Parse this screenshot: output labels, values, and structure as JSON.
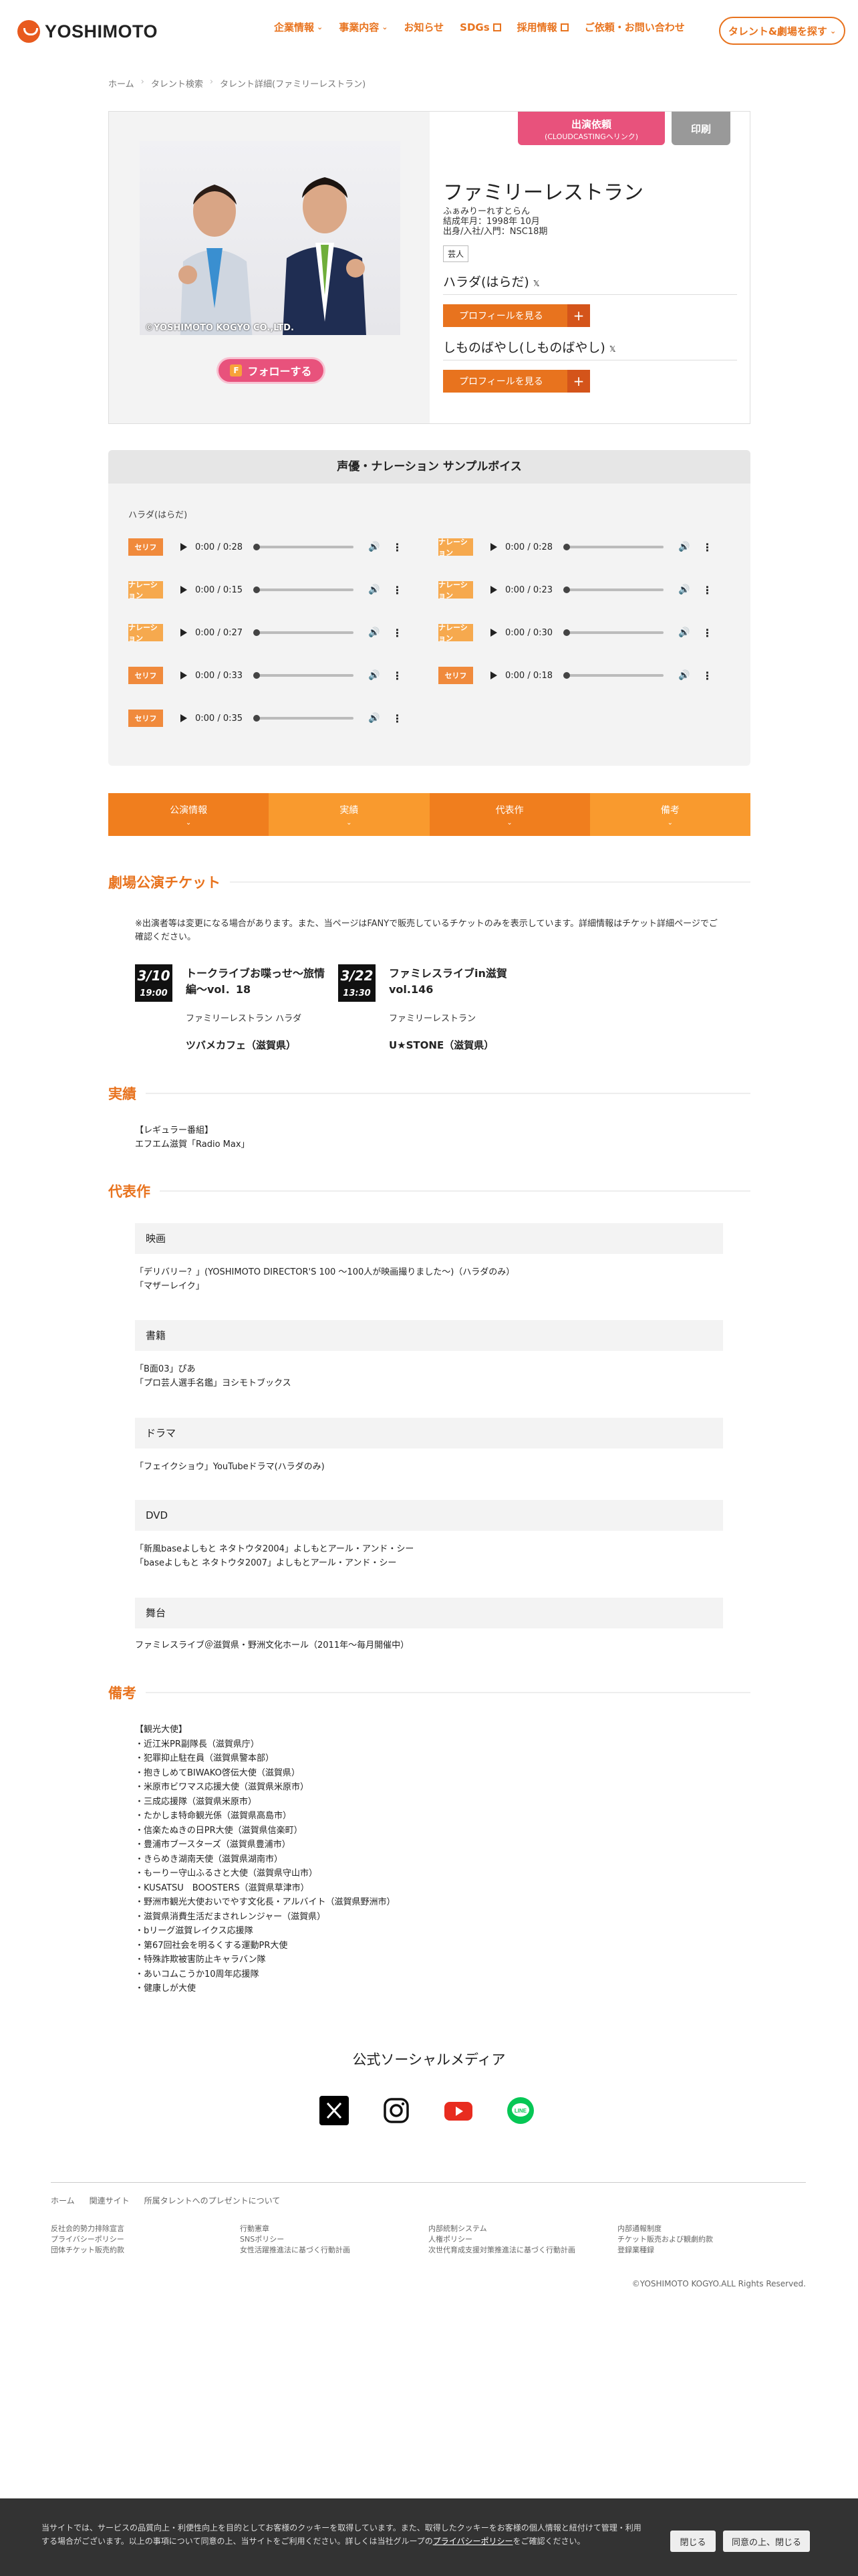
{
  "header": {
    "logo": "YOSHIMOTO",
    "nav": [
      {
        "label": "企業情報",
        "type": "dropdown"
      },
      {
        "label": "事業内容",
        "type": "dropdown"
      },
      {
        "label": "お知らせ",
        "type": "link"
      },
      {
        "label": "SDGs",
        "type": "external"
      },
      {
        "label": "採用情報",
        "type": "external"
      },
      {
        "label": "ご依頼・お問い合わせ",
        "type": "link"
      }
    ],
    "talent_button": "タレント&劇場を探す"
  },
  "breadcrumb": [
    "ホーム",
    "タレント検索",
    "タレント詳細(ファミリーレストラン)"
  ],
  "profile": {
    "photo_caption": "©YOSHIMOTO KOGYO CO.,LTD.",
    "follow": "フォローする",
    "order_line1": "出演依頼",
    "order_line2": "(CLOUDCASTINGへリンク)",
    "print": "印刷",
    "name": "ファミリーレストラン",
    "kana": "ふぁみりーれすとらん",
    "formed": "結成年月：1998年 10月",
    "origin": "出身/入社/入門：NSC18期",
    "tag": "芸人",
    "members": [
      {
        "name": "ハラダ(はらだ)",
        "button": "プロフィールを見る"
      },
      {
        "name": "しものばやし(しものばやし)",
        "button": "プロフィールを見る"
      }
    ]
  },
  "voice": {
    "title": "声優・ナレーション サンプルボイス",
    "subtitle": "ハラダ(はらだ)",
    "tracks": [
      {
        "badge": "セリフ",
        "time": "0:00 / 0:28",
        "color": "#f08a3c"
      },
      {
        "badge": "ナレーション",
        "time": "0:00 / 0:28",
        "color": "#f6a94e"
      },
      {
        "badge": "ナレーション",
        "time": "0:00 / 0:15",
        "color": "#f6a94e"
      },
      {
        "badge": "ナレーション",
        "time": "0:00 / 0:23",
        "color": "#f6a94e"
      },
      {
        "badge": "ナレーション",
        "time": "0:00 / 0:27",
        "color": "#f6a94e"
      },
      {
        "badge": "ナレーション",
        "time": "0:00 / 0:30",
        "color": "#f6a94e"
      },
      {
        "badge": "セリフ",
        "time": "0:00 / 0:33",
        "color": "#f08a3c"
      },
      {
        "badge": "セリフ",
        "time": "0:00 / 0:18",
        "color": "#f08a3c"
      },
      {
        "badge": "セリフ",
        "time": "0:00 / 0:35",
        "color": "#f08a3c"
      }
    ]
  },
  "tabs": [
    "公演情報",
    "実績",
    "代表作",
    "備考"
  ],
  "tickets": {
    "heading": "劇場公演チケット",
    "note": "※出演者等は変更になる場合があります。また、当ページはFANYで販売しているチケットのみを表示しています。詳細情報はチケット詳細ページでご確認ください。",
    "items": [
      {
        "date": "3/10",
        "time": "19:00",
        "title": "トークライブお喋っせ〜旅情編〜vol．18",
        "cast": "ファミリーレストラン ハラダ",
        "venue": "ツバメカフェ（滋賀県）"
      },
      {
        "date": "3/22",
        "time": "13:30",
        "title": "ファミレスライブin滋賀vol.146",
        "cast": "ファミリーレストラン",
        "venue": "U★STONE（滋賀県）"
      }
    ]
  },
  "achievements": {
    "heading": "実績",
    "lines": [
      "【レギュラー番組】",
      "エフエム滋賀「Radio Max」"
    ]
  },
  "works": {
    "heading": "代表作",
    "groups": [
      {
        "title": "映画",
        "lines": [
          "「デリバリー？」(YOSHIMOTO DIRECTOR'S 100 〜100人が映画撮りました〜)（ハラダのみ）",
          "「マザーレイク」"
        ]
      },
      {
        "title": "書籍",
        "lines": [
          "「B面03」ぴあ",
          "「プロ芸人選手名鑑」ヨシモトブックス"
        ]
      },
      {
        "title": "ドラマ",
        "lines": [
          "「フェイクショウ」YouTubeドラマ(ハラダのみ)"
        ]
      },
      {
        "title": "DVD",
        "lines": [
          "「新風baseよしもと ネタトウタ2004」よしもとアール・アンド・シー",
          "「baseよしもと ネタトウタ2007」よしもとアール・アンド・シー"
        ]
      },
      {
        "title": "舞台",
        "lines": [
          "ファミレスライブ＠滋賀県・野洲文化ホール（2011年〜毎月開催中）"
        ]
      }
    ]
  },
  "remarks": {
    "heading": "備考",
    "lines": [
      "【観光大使】",
      "・近江米PR副隊長（滋賀県庁）",
      "・犯罪抑止駐在員（滋賀県警本部）",
      "・抱きしめてBIWAKO啓伝大使（滋賀県）",
      "・米原市ビワマス応援大使（滋賀県米原市）",
      "・三成応援隊（滋賀県米原市）",
      "・たかしま特命観光係（滋賀県高島市）",
      "・信楽たぬきの日PR大使（滋賀県信楽町）",
      "・豊浦市ブースターズ（滋賀県豊浦市）",
      "・きらめき湖南天使（滋賀県湖南市）",
      "・もーりー守山ふるさと大使（滋賀県守山市）",
      "・KUSATSU　BOOSTERS（滋賀県草津市）",
      "・野洲市観光大使おいでやす文化長・アルバイト（滋賀県野洲市）",
      "・滋賀県消費生活だまされレンジャー（滋賀県）",
      "・bリーグ滋賀レイクス応援隊",
      "・第67回社会を明るくする運動PR大使",
      "・特殊詐欺被害防止キャラバン隊",
      "・あいコムこうか10周年応援隊",
      "・健康しが大使"
    ]
  },
  "social": {
    "title": "公式ソーシャルメディア",
    "icons": [
      "x-icon",
      "instagram-icon",
      "youtube-icon",
      "line-icon"
    ]
  },
  "footer": {
    "links": [
      "ホーム",
      "関連サイト",
      "所属タレントへのプレゼントについて"
    ],
    "col1": [
      "反社会的勢力排除宣言",
      "プライバシーポリシー",
      "団体チケット販売約款"
    ],
    "col2": [
      "行動憲章",
      "SNSポリシー",
      "女性活躍推進法に基づく行動計画"
    ],
    "col3": [
      "内部統制システム",
      "人権ポリシー",
      "次世代育成支援対策推進法に基づく行動計画"
    ],
    "col4": [
      "内部通報制度",
      "チケット販売および観劇約款",
      "登録業種録"
    ],
    "copyright": "©YOSHIMOTO KOGYO.ALL Rights Reserved."
  },
  "cookie": {
    "text": "当サイトでは、サービスの品質向上・利便性向上を目的としてお客様のクッキーを取得しています。また、取得したクッキーをお客様の個人情報と紐付けて管理・利用する場合がございます。以上の事項について同意の上、当サイトをご利用ください。詳しくは当社グループの",
    "policy_link": "プライバシーポリシー",
    "text_end": "をご確認ください。",
    "close": "閉じる",
    "agree": "同意の上、閉じる"
  }
}
